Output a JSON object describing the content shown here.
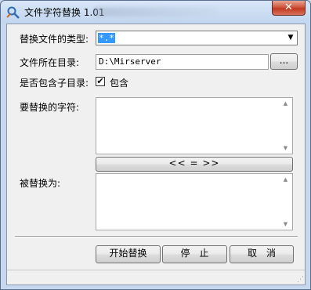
{
  "window": {
    "title": "文件字符替换 1.01",
    "close_label": "✕"
  },
  "form": {
    "file_type_label": "替换文件的类型:",
    "file_type_value": "*.*",
    "directory_label": "文件所在目录:",
    "directory_value": "D:\\Mirserver",
    "browse_label": "...",
    "include_subdirs_label": "是否包含子目录:",
    "include_subdirs_checked": true,
    "include_subdirs_check_mark": "✔",
    "include_subdirs_option": "包含",
    "find_label": "要替换的字符:",
    "find_value": "",
    "swap_label": "<< = >>",
    "replace_label": "被替换为:",
    "replace_value": ""
  },
  "buttons": {
    "start": "开始替换",
    "stop": "停　止",
    "cancel": "取　消"
  },
  "statusbar": {
    "text": ""
  }
}
